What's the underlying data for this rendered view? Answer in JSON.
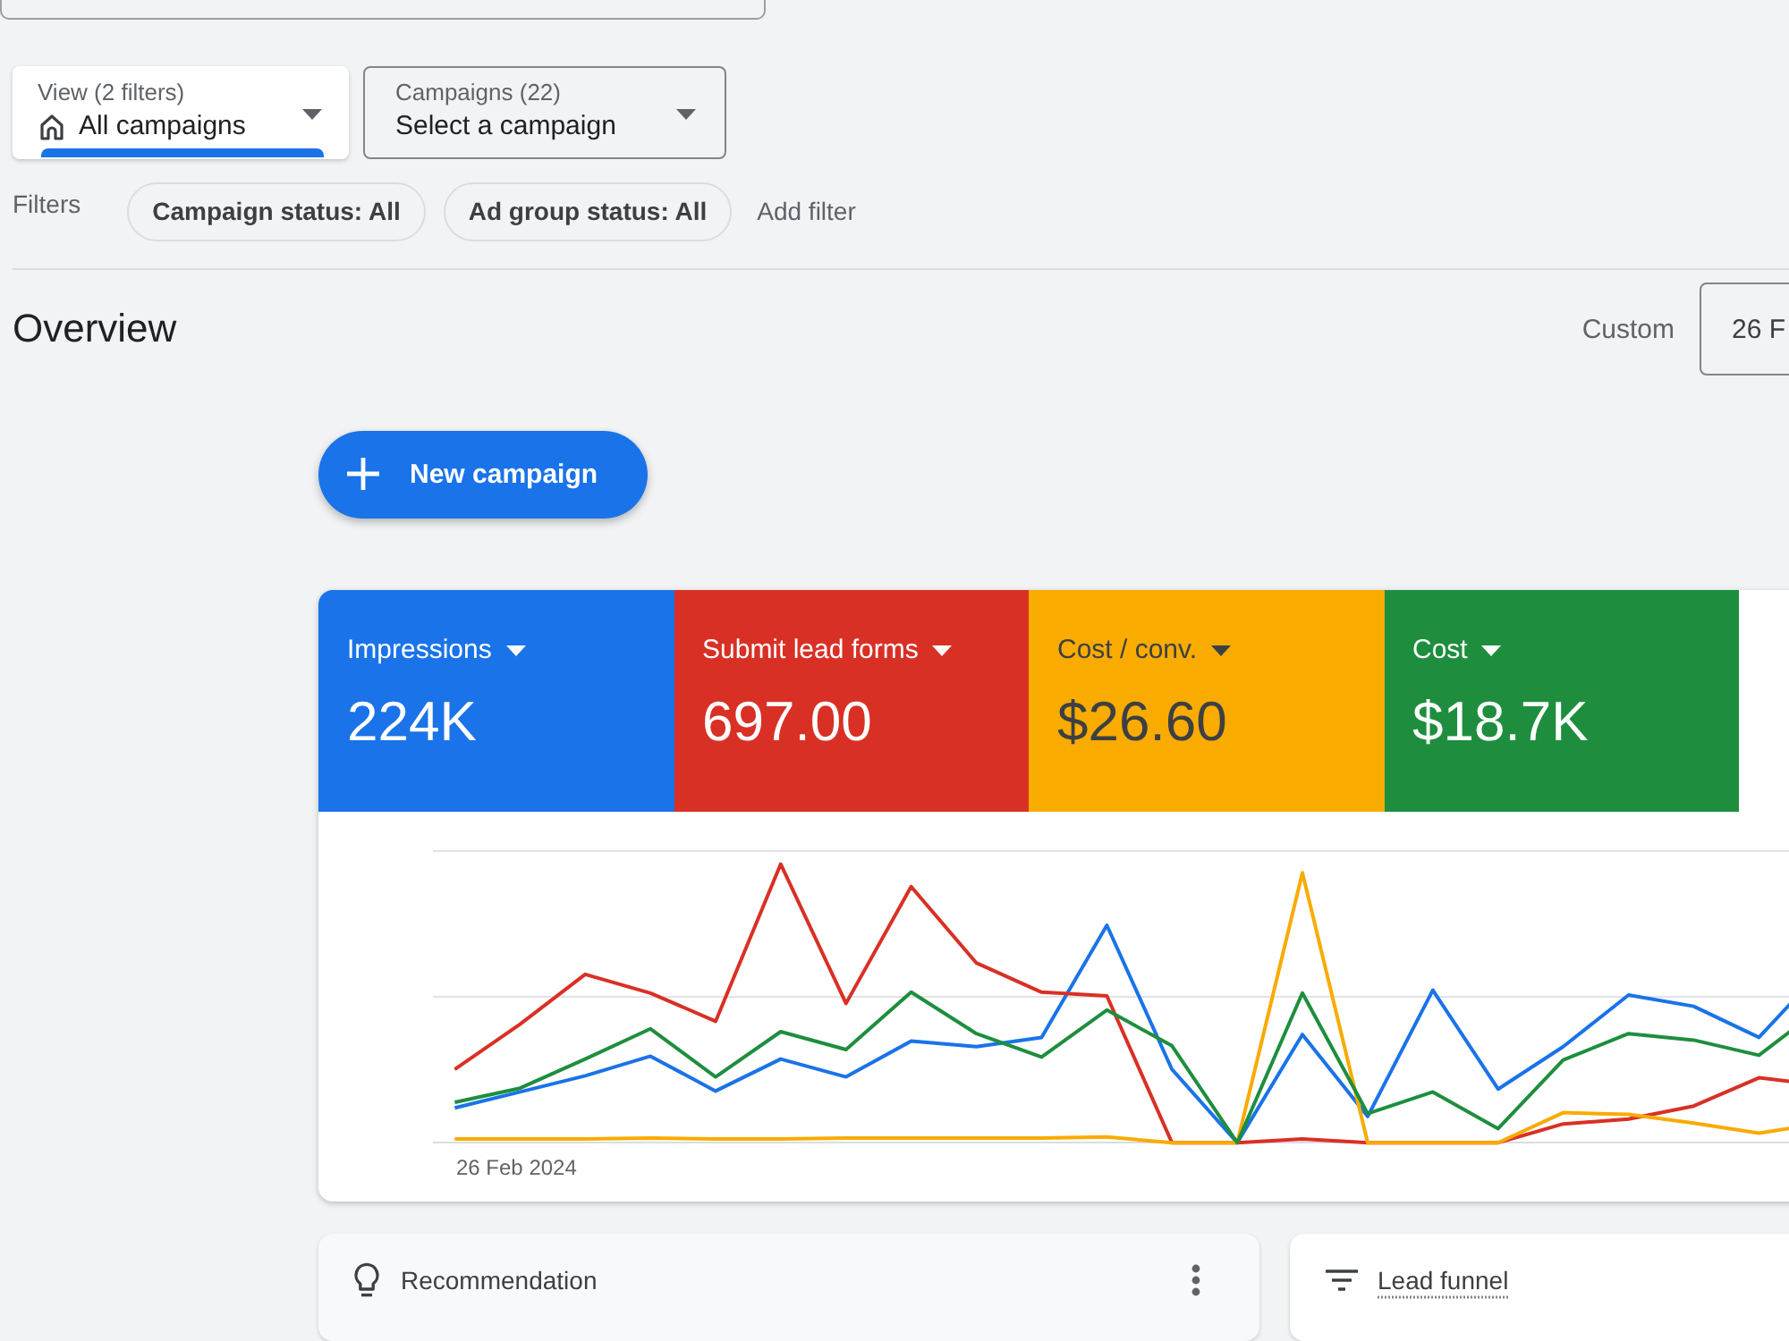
{
  "selectors": [
    {
      "kind": "view",
      "label": "View (2 filters)",
      "value": "All campaigns",
      "selected": true
    },
    {
      "kind": "campaign",
      "label": "Campaigns (22)",
      "value": "Select a campaign",
      "selected": false
    }
  ],
  "filters": {
    "label": "Filters",
    "chips": [
      "Campaign status: All",
      "Ad group status: All"
    ],
    "add_label": "Add filter"
  },
  "overview": {
    "title": "Overview",
    "date_range_label": "Custom",
    "date_range_value": "26 F"
  },
  "new_campaign_button": {
    "label": "New campaign"
  },
  "metrics": [
    {
      "label": "Impressions",
      "value": "224K",
      "color": "#1a73e8"
    },
    {
      "label": "Submit lead forms",
      "value": "697.00",
      "color": "#d93025"
    },
    {
      "label": "Cost / conv.",
      "value": "$26.60",
      "color": "#f9ab00"
    },
    {
      "label": "Cost",
      "value": "$18.7K",
      "color": "#1e8e3e"
    }
  ],
  "chart": {
    "start_date": "26 Feb 2024"
  },
  "cards": [
    {
      "kind": "recommendation",
      "title": "Recommendation"
    },
    {
      "kind": "funnel",
      "title": "Lead funnel"
    }
  ]
}
